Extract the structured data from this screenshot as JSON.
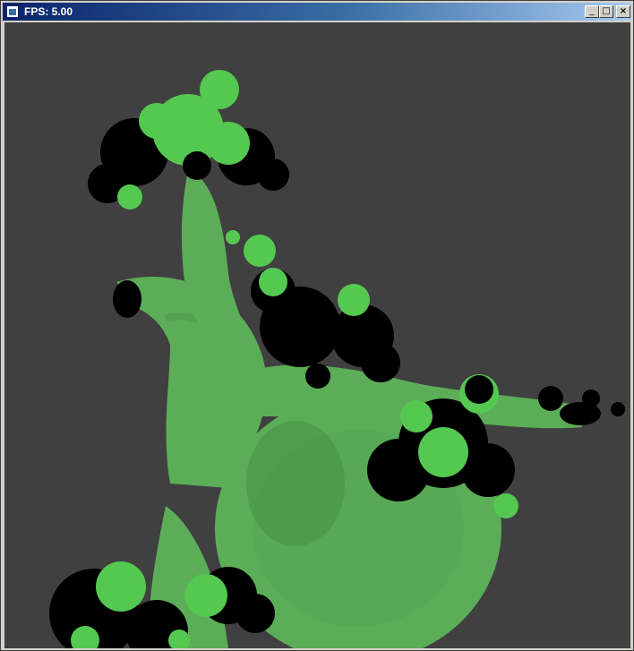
{
  "window": {
    "title": "FPS: 5.00",
    "buttons": {
      "minimize": "_",
      "maximize": "□",
      "close": "×"
    }
  },
  "scene": {
    "background_color": "#404040",
    "trunk_color": "#5cad58",
    "leaf_light_color": "#55c851",
    "leaf_dark_color": "#000000",
    "hole_color": "#000000"
  }
}
